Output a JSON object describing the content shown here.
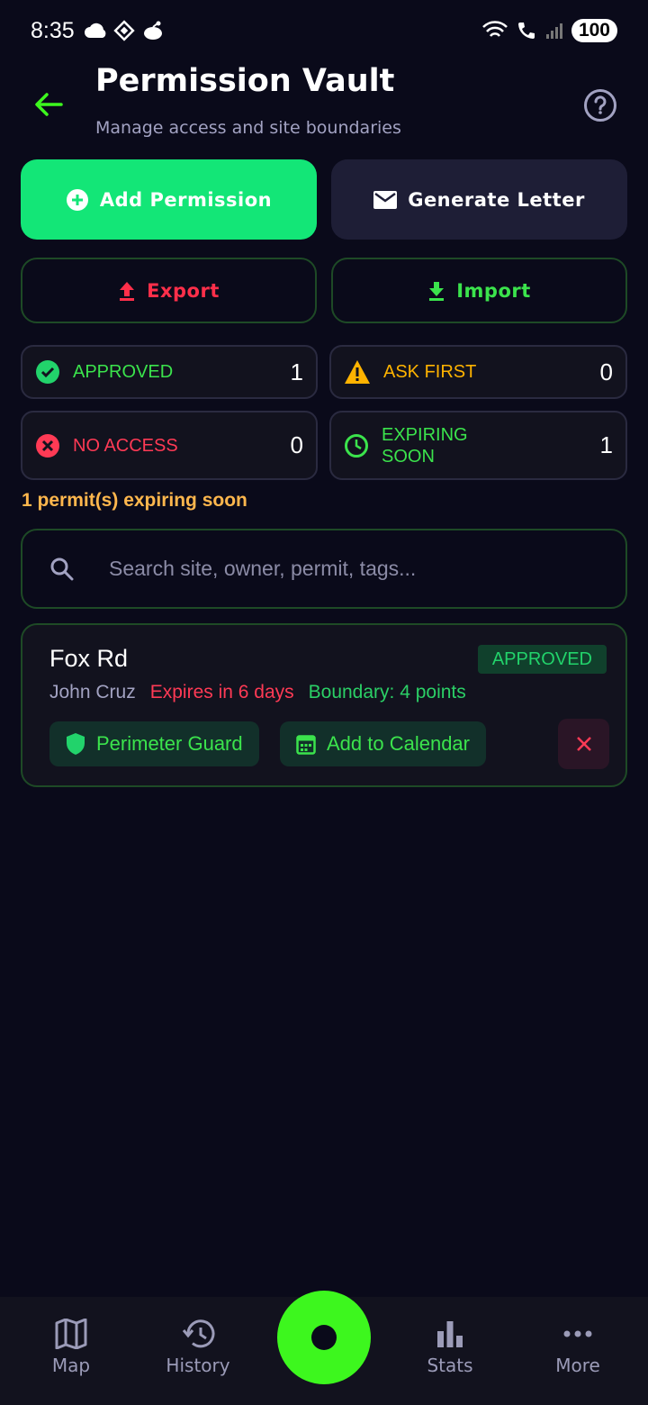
{
  "status_bar": {
    "time": "8:35",
    "battery": "100"
  },
  "header": {
    "title": "Permission Vault",
    "subtitle": "Manage access and site boundaries"
  },
  "actions": {
    "add_permission": "Add Permission",
    "generate_letter": "Generate Letter",
    "export": "Export",
    "import": "Import"
  },
  "stats": [
    {
      "label": "APPROVED",
      "count": "1",
      "color": "#3be34c",
      "icon": "check-circle-icon"
    },
    {
      "label": "ASK FIRST",
      "count": "0",
      "color": "#ffb300",
      "icon": "warning-icon"
    },
    {
      "label": "NO ACCESS",
      "count": "0",
      "color": "#ff3a55",
      "icon": "cancel-circle-icon"
    },
    {
      "label": "EXPIRING\nSOON",
      "count": "1",
      "color": "#3be34c",
      "icon": "clock-icon"
    }
  ],
  "expiring_notice": "1 permit(s) expiring soon",
  "search": {
    "placeholder": "Search site, owner, permit, tags..."
  },
  "permissions": [
    {
      "site": "Fox Rd",
      "status": "APPROVED",
      "owner": "John Cruz",
      "expiry": "Expires in 6 days",
      "boundary": "Boundary: 4 points",
      "chip_guard": "Perimeter Guard",
      "chip_calendar": "Add to Calendar"
    }
  ],
  "bottom_nav": {
    "map": "Map",
    "history": "History",
    "stats": "Stats",
    "more": "More"
  },
  "colors": {
    "background": "#0a0a1a",
    "accent_green": "#13e677",
    "fab_green": "#3df71e",
    "danger": "#ff3a55"
  }
}
